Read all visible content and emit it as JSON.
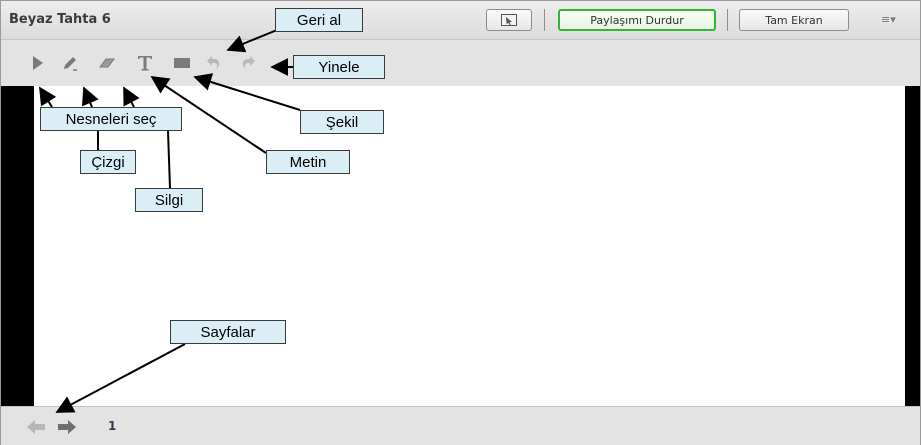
{
  "window": {
    "title": "Beyaz Tahta 6",
    "buttons": {
      "stop_sharing": "Paylaşımı Durdur",
      "fullscreen": "Tam Ekran"
    },
    "menu_icon": "≡▾"
  },
  "toolbar": {
    "tools": [
      "select-arrow-icon",
      "pencil-icon",
      "eraser-icon",
      "text-tool-icon",
      "rectangle-shape-icon",
      "undo-icon",
      "redo-icon"
    ]
  },
  "pager": {
    "page_number": "1",
    "icons": [
      "prev-arrow-icon",
      "next-arrow-icon"
    ]
  },
  "annotations": {
    "geri_al": "Geri al",
    "yinele": "Yinele",
    "nesneleri_sec": "Nesneleri seç",
    "sekil": "Şekil",
    "cizgi": "Çizgi",
    "metin": "Metin",
    "silgi": "Silgi",
    "sayfalar": "Sayfalar"
  },
  "colors": {
    "accent_green": "#2eb82e",
    "callout_fill": "#dbeef6",
    "tool_gray": "#7f7f7f"
  }
}
